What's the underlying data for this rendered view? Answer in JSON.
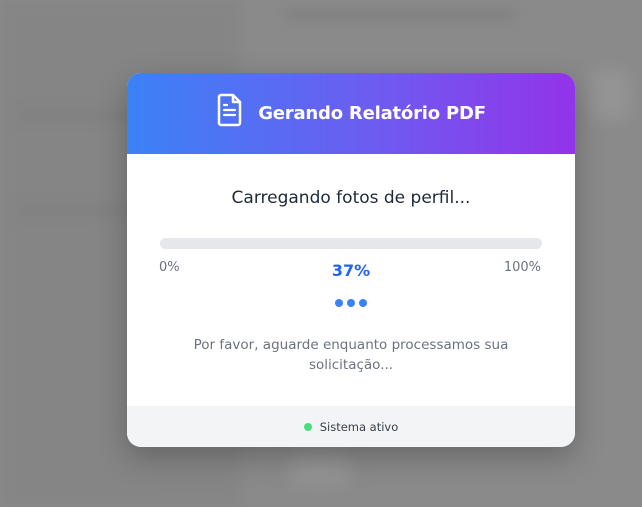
{
  "modal": {
    "title": "Gerando Relatório PDF",
    "header_icon": "document-icon",
    "status_text": "Carregando fotos de perfil...",
    "progress": {
      "value_percent": 37,
      "label": "37%",
      "min_label": "0%",
      "max_label": "100%"
    },
    "message": "Por favor, aguarde enquanto processamos sua solicitação...",
    "footer": {
      "status_label": "Sistema ativo",
      "status_color": "#4ade80"
    }
  },
  "colors": {
    "header_gradient_start": "#3b82f6",
    "header_gradient_end": "#9333ea",
    "accent": "#2563eb",
    "overlay": "#8a8a8a"
  }
}
